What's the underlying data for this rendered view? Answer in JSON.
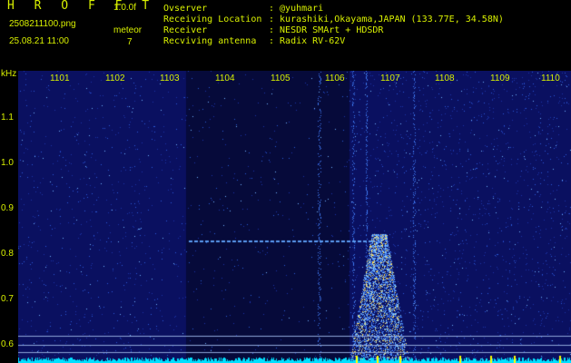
{
  "header": {
    "brand": "H R O F F T",
    "version": "1.0.0f",
    "filename": "2508211100.png",
    "datetime": "25.08.21 11:00",
    "event_label": "meteor",
    "event_count": "7",
    "info": [
      {
        "label": "Ovserver",
        "value": ": @yuhmari"
      },
      {
        "label": "Receiving Location",
        "value": ": kurashiki,Okayama,JAPAN (133.77E, 34.58N)"
      },
      {
        "label": "Receiver",
        "value": ": NESDR SMArt + HDSDR"
      },
      {
        "label": "Recviving antenna",
        "value": ": Radix RV-62V"
      }
    ]
  },
  "plot": {
    "y_unit": "kHz",
    "y_ticks": [
      "1.1",
      "1.0",
      "0.9",
      "0.8",
      "0.7",
      "0.6"
    ],
    "x_ticks": [
      "1101",
      "1102",
      "1103",
      "1104",
      "1105",
      "1106",
      "1107",
      "1108",
      "1109",
      "1110"
    ],
    "colors": {
      "background": "#0a1060",
      "text": "#d8f000",
      "baseline": "#00e0ff",
      "marker": "#ffff00"
    }
  }
}
